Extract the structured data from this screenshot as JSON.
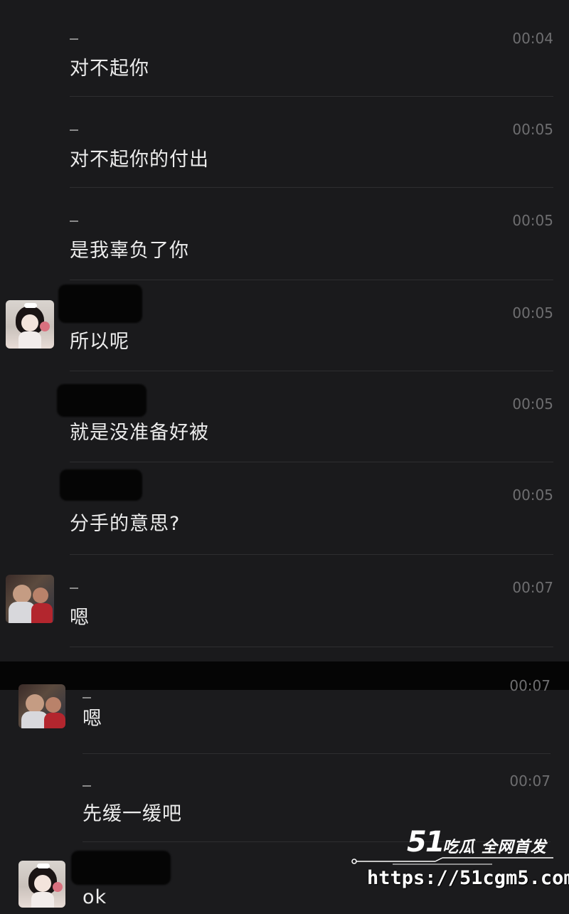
{
  "messages_top": [
    {
      "time": "00:04",
      "text": "对不起你",
      "has_sender_line": true
    },
    {
      "time": "00:05",
      "text": "对不起你的付出",
      "has_sender_line": true
    },
    {
      "time": "00:05",
      "text": "是我辜负了你",
      "has_sender_line": true
    },
    {
      "time": "00:05",
      "text": "所以呢",
      "has_sender_line": false
    },
    {
      "time": "00:05",
      "text": "就是没准备好被",
      "has_sender_line": false
    },
    {
      "time": "00:05",
      "text": "分手的意思?",
      "has_sender_line": false
    },
    {
      "time": "00:07",
      "text": "嗯",
      "has_sender_line": true
    }
  ],
  "messages_bottom": [
    {
      "time": "00:07",
      "text": "嗯",
      "has_sender_line": true
    },
    {
      "time": "00:07",
      "text": "先缓一缓吧",
      "has_sender_line": true
    },
    {
      "time": "00:07",
      "text": "ok",
      "has_sender_line": false
    }
  ],
  "watermark": {
    "logo_number": "51",
    "logo_text": "吃瓜 全网首发",
    "url": "https://51cgm5.com"
  },
  "colors": {
    "background": "#1c1c1e",
    "text": "#ececec",
    "time": "#6e6e70",
    "divider": "#2e2e30"
  }
}
